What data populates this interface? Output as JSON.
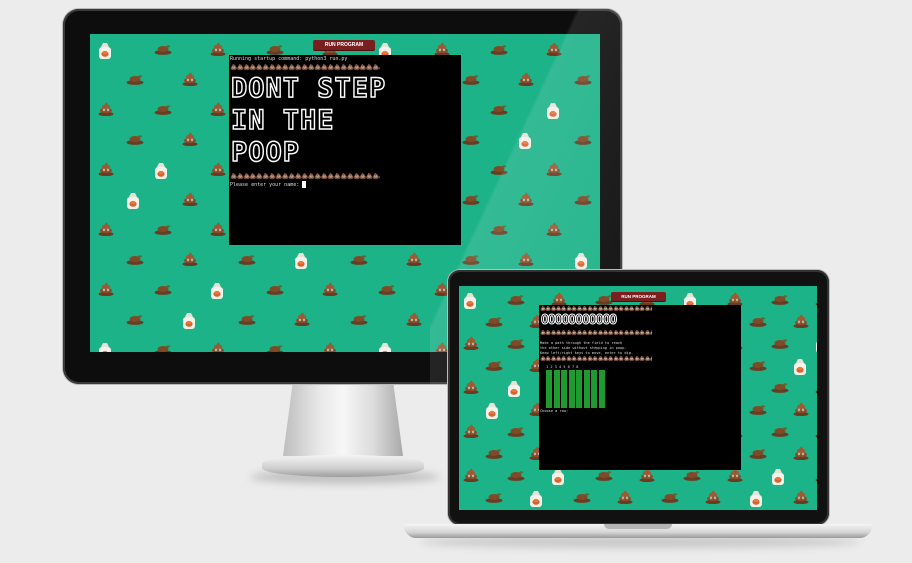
{
  "desktop": {
    "run_button": "RUN PROGRAM",
    "terminal": {
      "command_line": "Running startup command: python3 run.py",
      "poop_row": "💩💩💩💩💩💩💩💩💩💩💩💩💩💩💩💩💩💩💩💩💩💩💩💩💩💩💩💩💩💩",
      "title_lines": [
        "DONT STEP",
        "IN THE",
        "POOP"
      ],
      "prompt": "Please enter your name: "
    }
  },
  "laptop": {
    "run_button": "RUN PROGRAM",
    "terminal": {
      "poop_row": "💩💩💩💩💩💩💩💩💩💩💩💩💩💩💩💩💩💩💩💩💩💩💩💩💩💩💩💩💩💩💩💩💩💩💩💩",
      "circle_row": "OOOOOOOOOOO",
      "info_lines": [
        "Make a path through the field to reach",
        "the other side without stepping in poop.",
        "Keep left/right keys to move, enter to dig."
      ],
      "grid_header": "1 2 3 4 5 6 7 8",
      "answer_prompt": "Choose a row:"
    }
  },
  "colors": {
    "background": "#1db389",
    "button": "#7a1f1f",
    "terminal": "#000000",
    "poop": "#7a4a2a",
    "grid": "#1e9a2e"
  },
  "icons": [
    "poop-icon",
    "poop-bag-icon",
    "turd-icon"
  ]
}
